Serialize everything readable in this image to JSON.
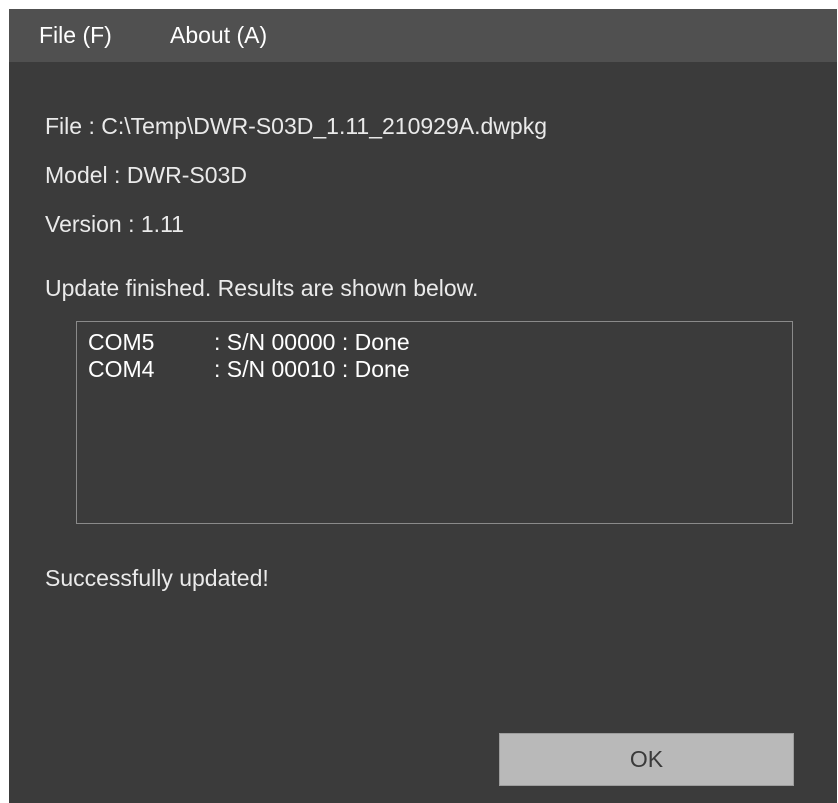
{
  "menu": {
    "file_label": "File (F)",
    "about_label": "About (A)"
  },
  "info": {
    "file": "File : C:\\Temp\\DWR-S03D_1.11_210929A.dwpkg",
    "model": "Model : DWR-S03D",
    "version": "Version :  1.11"
  },
  "status": {
    "update_message": "Update finished.  Results are shown below.",
    "success_message": "Successfully updated!"
  },
  "results": [
    {
      "port": "COM5",
      "detail": ": S/N 00000 : Done"
    },
    {
      "port": "COM4",
      "detail": ": S/N 00010 : Done"
    }
  ],
  "buttons": {
    "ok_label": "OK"
  },
  "colors": {
    "window_bg": "#3b3b3b",
    "menubar_bg": "#505050",
    "button_bg": "#b9b9b9"
  }
}
